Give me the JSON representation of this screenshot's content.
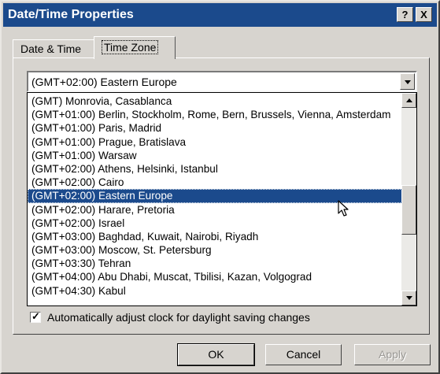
{
  "window": {
    "title": "Date/Time Properties",
    "help_label": "?",
    "close_label": "X"
  },
  "tabs": [
    {
      "label": "Date & Time",
      "selected": false
    },
    {
      "label": "Time Zone",
      "selected": true
    }
  ],
  "timezone": {
    "selected": "(GMT+02:00) Eastern Europe",
    "items": [
      "(GMT) Monrovia, Casablanca",
      "(GMT+01:00) Berlin, Stockholm, Rome, Bern, Brussels, Vienna, Amsterdam",
      "(GMT+01:00) Paris, Madrid",
      "(GMT+01:00) Prague, Bratislava",
      "(GMT+01:00) Warsaw",
      "(GMT+02:00) Athens, Helsinki, Istanbul",
      "(GMT+02:00) Cairo",
      "(GMT+02:00) Eastern Europe",
      "(GMT+02:00) Harare, Pretoria",
      "(GMT+02:00) Israel",
      "(GMT+03:00) Baghdad, Kuwait, Nairobi, Riyadh",
      "(GMT+03:00) Moscow, St. Petersburg",
      "(GMT+03:30) Tehran",
      "(GMT+04:00) Abu Dhabi, Muscat, Tbilisi, Kazan, Volgograd",
      "(GMT+04:30) Kabul"
    ],
    "highlighted_index": 7
  },
  "daylight": {
    "label": "Automatically adjust clock for daylight saving changes",
    "checked": true,
    "check_glyph": "✓"
  },
  "buttons": {
    "ok": "OK",
    "cancel": "Cancel",
    "apply": "Apply"
  },
  "colors": {
    "title_bar": "#1b4a8c",
    "selection": "#1b4a8c",
    "face": "#d7d4cf"
  }
}
